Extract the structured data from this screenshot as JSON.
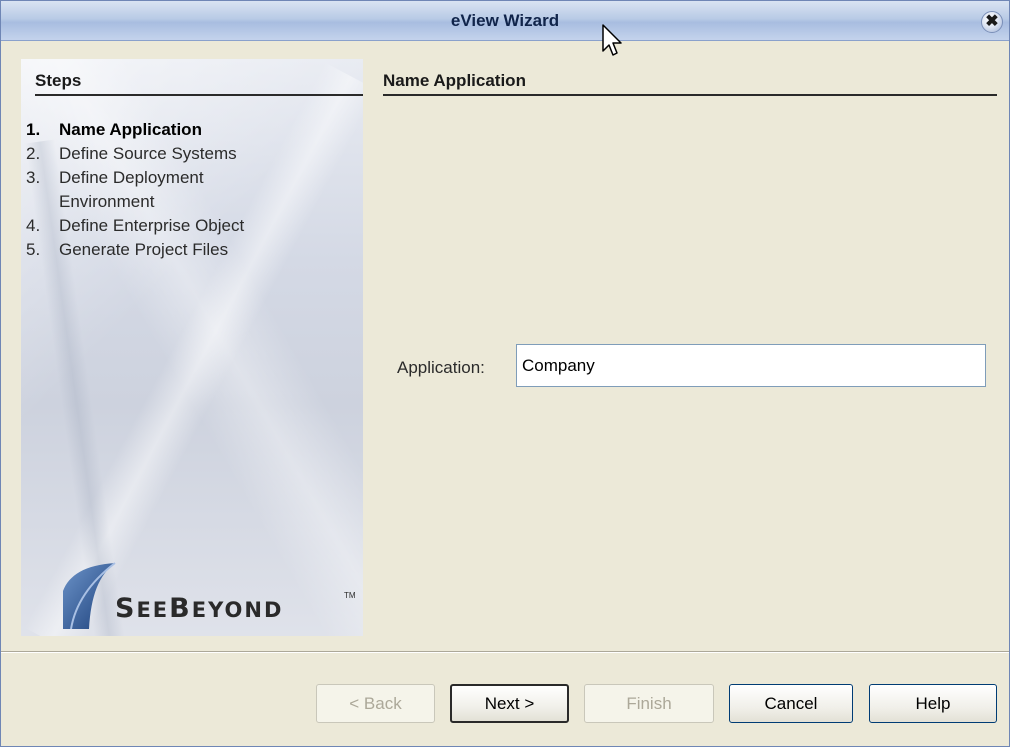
{
  "window": {
    "title": "eView Wizard",
    "close_glyph": "✖"
  },
  "steps": {
    "heading": "Steps",
    "items": [
      {
        "num": "1.",
        "label": "Name Application",
        "active": true
      },
      {
        "num": "2.",
        "label": "Define Source Systems",
        "active": false
      },
      {
        "num": "3.",
        "label": "Define Deployment",
        "active": false
      },
      {
        "num": "",
        "label": "Environment",
        "active": false
      },
      {
        "num": "4.",
        "label": "Define Enterprise Object",
        "active": false
      },
      {
        "num": "5.",
        "label": "Generate Project Files",
        "active": false
      }
    ],
    "logo_text_first": "S",
    "logo_text_rest": "EE",
    "logo_text_b": "B",
    "logo_text_end": "EYOND",
    "logo_tm": "TM"
  },
  "content": {
    "title": "Name Application",
    "application_label": "Application:",
    "application_value": "Company"
  },
  "buttons": {
    "back": "< Back",
    "next": "Next >",
    "finish": "Finish",
    "cancel": "Cancel",
    "help": "Help"
  }
}
